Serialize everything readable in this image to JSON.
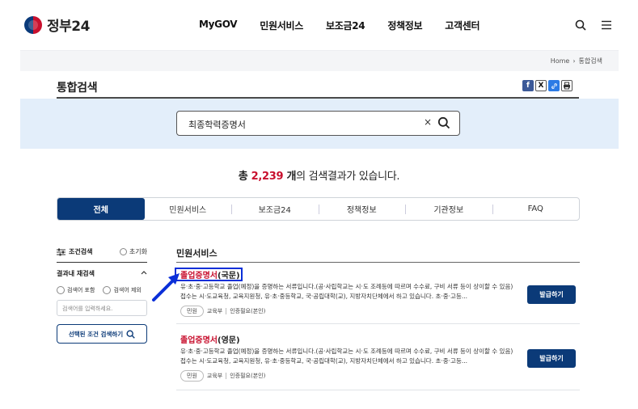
{
  "header": {
    "logo_text": "정부24",
    "nav": [
      "MyGOV",
      "민원서비스",
      "보조금24",
      "정책정보",
      "고객센터"
    ],
    "icons": [
      "search-icon",
      "menu-icon"
    ]
  },
  "breadcrumb": {
    "home": "Home",
    "current": "통합검색"
  },
  "page": {
    "title": "통합검색"
  },
  "share": {
    "icons": [
      "facebook-icon",
      "x-icon",
      "link-icon",
      "print-icon"
    ]
  },
  "search": {
    "value": "최종학력증명서",
    "clear": "×"
  },
  "result_count": {
    "prefix": "총 ",
    "number": "2,239",
    "unit": " 개",
    "suffix": "의 검색결과가 있습니다."
  },
  "tabs": [
    {
      "label": "전체",
      "active": true
    },
    {
      "label": "민원서비스",
      "active": false
    },
    {
      "label": "보조금24",
      "active": false
    },
    {
      "label": "정책정보",
      "active": false
    },
    {
      "label": "기관정보",
      "active": false
    },
    {
      "label": "FAQ",
      "active": false
    }
  ],
  "filter": {
    "title": "조건검색",
    "reset": "초기화",
    "re_search": "결과내 재검색",
    "radio_include": "검색어 포함",
    "radio_exclude": "검색어 제외",
    "input_placeholder": "검색어를 입력하세요.",
    "button": "선택된 조건 검색하기"
  },
  "results_section": {
    "title": "민원서비스",
    "items": [
      {
        "title_highlight": "졸업증명서",
        "title_rest": "(국문)",
        "desc": "유·초·중·고등학교 졸업(예정)을 증명하는 서류입니다.(공·사립학교는 시·도 조례등에 따르며 수수료, 구비 서류 등이 상이할 수 있음) 접수는 시·도교육청, 교육지원청, 유·초·중등학교, 국·공립대학(교), 지방자치단체에서 하고 있습니다. 초·중·고등...",
        "badge": "민원",
        "org": "교육부",
        "auth": "인증필요(본인)",
        "button": "발급하기"
      },
      {
        "title_highlight": "졸업증명서",
        "title_rest": "(영문)",
        "desc": "유·초·중·고등학교 졸업(예정)을 증명하는 서류입니다.(공·사립학교는 시·도 조례등에 따르며 수수료, 구비 서류 등이 상이할 수 있음) 접수는 시·도교육청, 교육지원청, 유·초·중등학교, 국·공립대학(교), 지방자치단체에서 하고 있습니다. 초·중·고등...",
        "badge": "민원",
        "org": "교육부",
        "auth": "인증필요(본인)",
        "button": "발급하기"
      }
    ]
  },
  "colors": {
    "primary": "#0b3a78",
    "highlight": "#c8102e",
    "annotation": "#0a2fd8",
    "search_band": "#e3eefa"
  }
}
